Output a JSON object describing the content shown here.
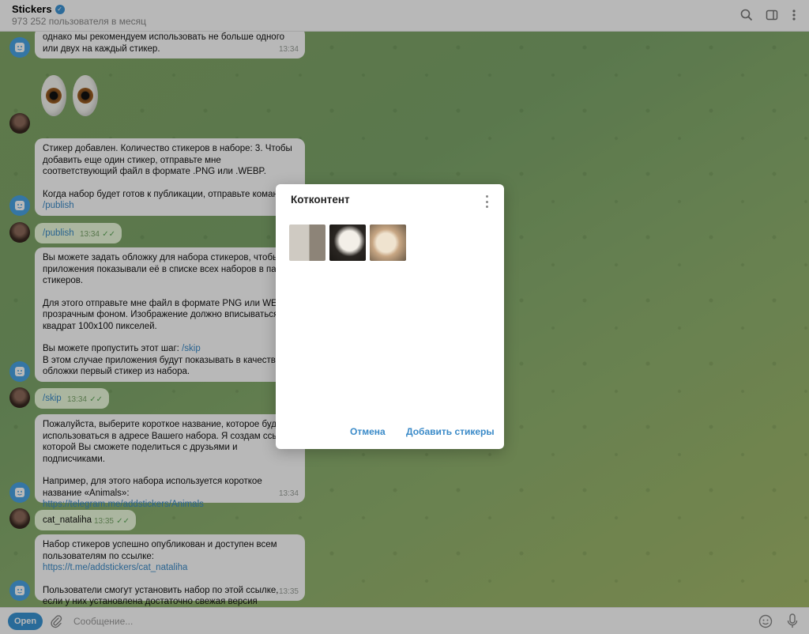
{
  "header": {
    "title": "Stickers",
    "subtitle": "973 252 пользователя в месяц"
  },
  "messages": {
    "m1": {
      "text": "однако мы рекомендуем использовать не больше одного или двух на каждый стикер.",
      "time": "13:34"
    },
    "m2": {
      "p1_a": "Стикер добавлен. Количество стикеров в наборе: 3. Чтобы добавить еще один стикер, отправьте мне соответствующий файл в формате .PNG или .WEBP.",
      "p2_a": "Когда набор будет готов к публикации, отправьте команду",
      "p2_link": "/publish"
    },
    "u1": {
      "text": "/publish",
      "time": "13:34"
    },
    "m3": {
      "p1": "Вы можете задать обложку для набора стикеров, чтобы приложения показывали её в списке всех наборов в панели стикеров.",
      "p2": "Для этого отправьте мне файл в формате PNG или WEBP с прозрачным фоном. Изображение должно вписываться в квадрат 100x100 пикселей.",
      "p3_a": "Вы можете пропустить этот шаг:",
      "p3_link": "/skip",
      "p3_b": "В этом случае приложения будут показывать в качестве обложки первый стикер из набора."
    },
    "u2": {
      "text": "/skip",
      "time": "13:34"
    },
    "m4": {
      "p1": "Пожалуйста, выберите короткое название, которое будет использоваться в адресе Вашего набора. Я создам ссылку, которой Вы сможете поделиться с друзьями и подписчиками.",
      "p2_a": "Например, для этого набора используется короткое название «Animals»:",
      "p2_link": "https://telegram.me/addstickers/Animals",
      "time": "13:34"
    },
    "u3": {
      "text": "cat_nataliha",
      "time": "13:35"
    },
    "m5": {
      "p1_a": "Набор стикеров успешно опубликован и доступен всем пользователям по ссылке:",
      "p1_link": "https://t.me/addstickers/cat_nataliha",
      "p2": "Пользователи смогут установить набор по этой ссылке, если у них установлена достаточно свежая версия Telegram.",
      "time": "13:35"
    }
  },
  "composer": {
    "open_label": "Open",
    "placeholder": "Сообщение..."
  },
  "modal": {
    "title": "Котконтент",
    "cancel_label": "Отмена",
    "add_label": "Добавить стикеры"
  },
  "colors": {
    "accent": "#3a8ac8",
    "own_bubble": "#eefdde"
  }
}
